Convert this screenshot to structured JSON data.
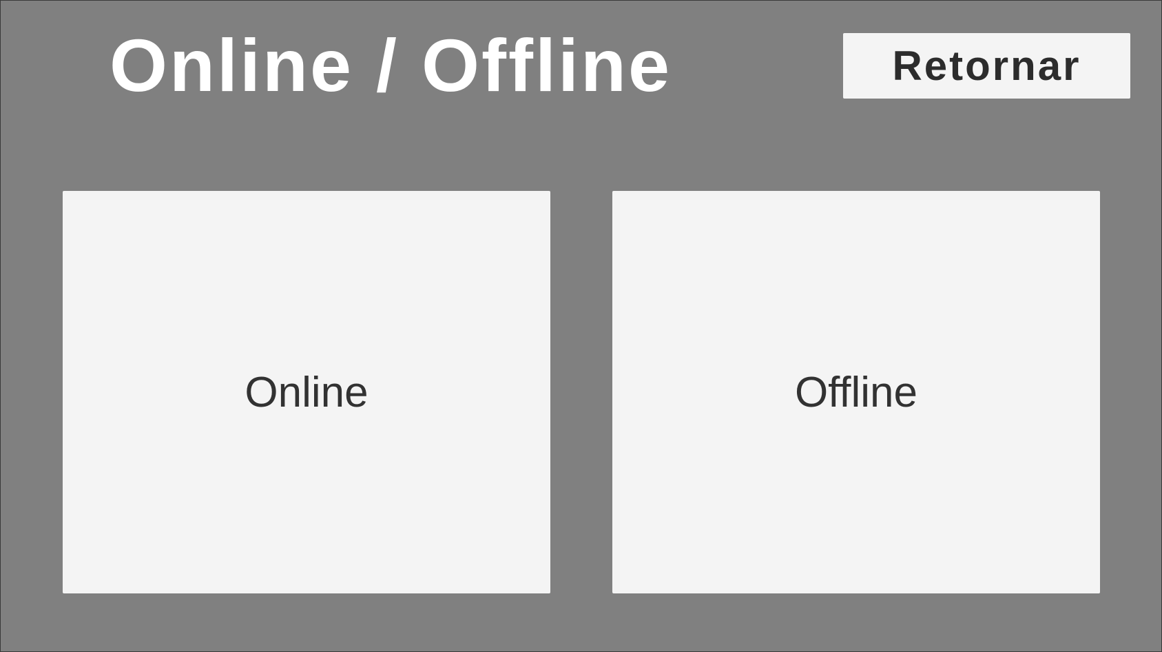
{
  "header": {
    "title": "Online / Offline",
    "return_label": "Retornar"
  },
  "modes": {
    "online_label": "Online",
    "offline_label": "Offline"
  },
  "colors": {
    "background": "#808080",
    "panel": "#f4f4f4",
    "title_text": "#ffffff",
    "button_text": "#2c2c2c"
  }
}
